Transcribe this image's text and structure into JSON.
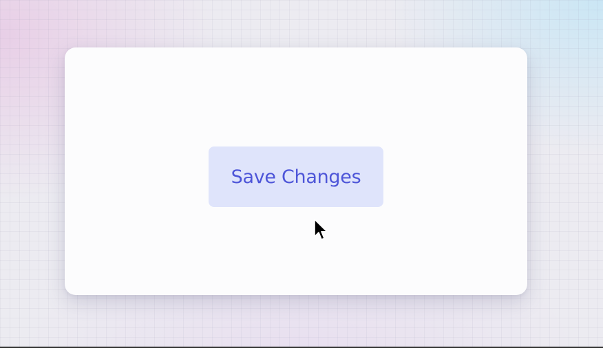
{
  "card": {
    "save_button_label": "Save Changes"
  },
  "cursor": {
    "icon": "arrow-cursor-icon"
  },
  "colors": {
    "button_background": "#dfe4fb",
    "button_text": "#4d55d8",
    "card_background": "#fcfcfd"
  }
}
